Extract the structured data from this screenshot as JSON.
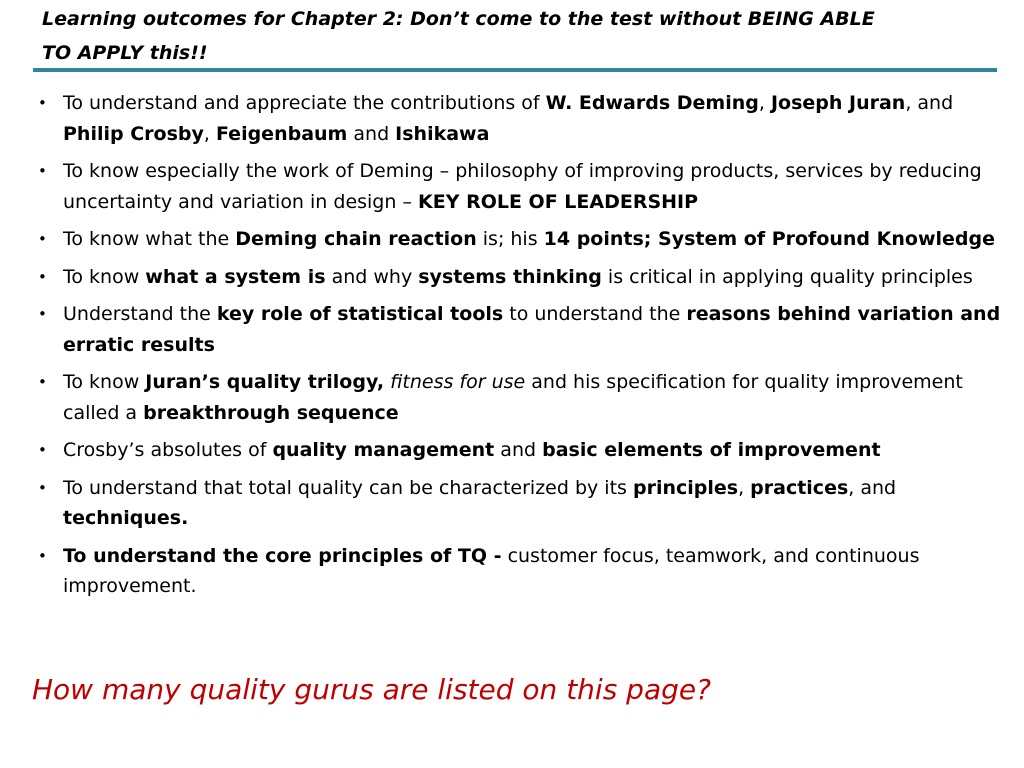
{
  "title": {
    "line1": "Learning outcomes for Chapter 2: Don’t come to the test without BEING ABLE",
    "line2": "TO APPLY this!!"
  },
  "colors": {
    "title_rule": "#31849b",
    "question_text": "#c00000"
  },
  "bullet_icon": "bullet-dot-icon",
  "outcomes": [
    {
      "segments": [
        {
          "text": "To understand and appreciate the contributions of ",
          "style": "normal"
        },
        {
          "text": "W. Edwards Deming",
          "style": "bold"
        },
        {
          "text": ", ",
          "style": "normal"
        },
        {
          "text": "Joseph Juran",
          "style": "bold"
        },
        {
          "text": ", and ",
          "style": "normal"
        },
        {
          "text": "Philip Crosby",
          "style": "bold"
        },
        {
          "text": ", ",
          "style": "normal"
        },
        {
          "text": "Feigenbaum",
          "style": "bold"
        },
        {
          "text": " and ",
          "style": "normal"
        },
        {
          "text": "Ishikawa",
          "style": "bold"
        }
      ]
    },
    {
      "segments": [
        {
          "text": "To know especially the work of Deming – philosophy of improving products, services by reducing uncertainty and variation in design – ",
          "style": "normal"
        },
        {
          "text": "KEY ROLE OF LEADERSHIP",
          "style": "bold"
        }
      ]
    },
    {
      "segments": [
        {
          "text": "To know what the ",
          "style": "normal"
        },
        {
          "text": "Deming chain reaction",
          "style": "bold"
        },
        {
          "text": " is; his ",
          "style": "normal"
        },
        {
          "text": "14 points; System of Profound Knowledge",
          "style": "bold"
        }
      ]
    },
    {
      "segments": [
        {
          "text": "To know ",
          "style": "normal"
        },
        {
          "text": "what a system is",
          "style": "bold"
        },
        {
          "text": " and why ",
          "style": "normal"
        },
        {
          "text": "systems thinking",
          "style": "bold"
        },
        {
          "text": " is critical in applying quality principles",
          "style": "normal"
        }
      ]
    },
    {
      "segments": [
        {
          "text": "Understand the ",
          "style": "normal"
        },
        {
          "text": "key role of statistical tools",
          "style": "bold"
        },
        {
          "text": " to understand the ",
          "style": "normal"
        },
        {
          "text": "reasons behind variation and erratic results",
          "style": "bold"
        }
      ]
    },
    {
      "segments": [
        {
          "text": "To know ",
          "style": "normal"
        },
        {
          "text": "Juran’s quality trilogy,",
          "style": "bold"
        },
        {
          "text": " ",
          "style": "normal"
        },
        {
          "text": "fitness for use",
          "style": "italic"
        },
        {
          "text": " and his specification for quality improvement called a  ",
          "style": "normal"
        },
        {
          "text": "breakthrough sequence",
          "style": "bold"
        }
      ]
    },
    {
      "segments": [
        {
          "text": "Crosby’s absolutes of ",
          "style": "normal"
        },
        {
          "text": "quality management",
          "style": "bold"
        },
        {
          "text": " and ",
          "style": "normal"
        },
        {
          "text": "basic elements of improvement",
          "style": "bold"
        }
      ]
    },
    {
      "segments": [
        {
          "text": "To understand that total quality can be characterized by its ",
          "style": "normal"
        },
        {
          "text": "principles",
          "style": "bold"
        },
        {
          "text": ", ",
          "style": "normal"
        },
        {
          "text": "practices",
          "style": "bold"
        },
        {
          "text": ", and ",
          "style": "normal"
        },
        {
          "text": "techniques.",
          "style": "bold"
        }
      ]
    },
    {
      "segments": [
        {
          "text": "To understand the core principles of TQ -",
          "style": "bold"
        },
        {
          "text": " customer focus, teamwork, and continuous improvement.",
          "style": "normal"
        }
      ]
    }
  ],
  "question": "How many quality gurus are listed on this page?"
}
